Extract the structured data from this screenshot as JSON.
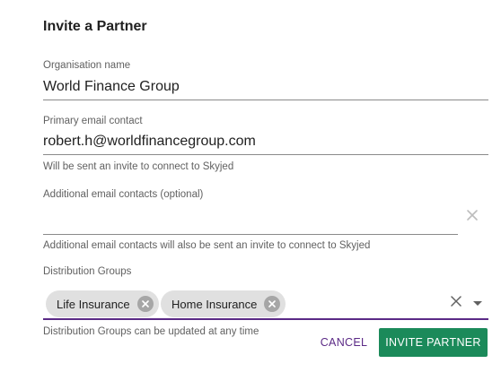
{
  "dialog": {
    "title": "Invite a Partner"
  },
  "organisation": {
    "label": "Organisation name",
    "value": "World Finance Group"
  },
  "primary_email": {
    "label": "Primary email contact",
    "value": "robert.h@worldfinancegroup.com",
    "helper": "Will be sent an invite to connect to Skyjed"
  },
  "additional_emails": {
    "label": "Additional email contacts (optional)",
    "value": "",
    "helper": "Additional email contacts will also be sent an invite to connect to Skyjed"
  },
  "distribution_groups": {
    "label": "Distribution Groups",
    "chips": [
      "Life Insurance",
      "Home Insurance"
    ],
    "helper": "Distribution Groups can be updated at any time"
  },
  "actions": {
    "cancel_label": "CANCEL",
    "invite_label": "INVITE PARTNER"
  },
  "colors": {
    "accent": "#5b2a86",
    "primary_button": "#1b8a5a"
  }
}
